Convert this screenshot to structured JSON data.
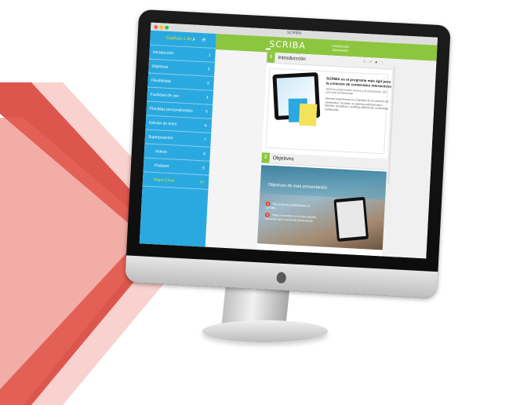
{
  "window": {
    "title": "SCRIBA"
  },
  "sidebar": {
    "chapter": "Capítulo 1 de 4",
    "items": [
      {
        "label": "Introducción",
        "num": "1"
      },
      {
        "label": "Objetivos",
        "num": "2"
      },
      {
        "label": "Flexibilidad",
        "num": "3"
      },
      {
        "label": "Facilidad de uso",
        "num": "4"
      },
      {
        "label": "Plantillas personalizadas",
        "num": "5"
      },
      {
        "label": "Edición de texto",
        "num": "6"
      },
      {
        "label": "Superposición",
        "num": "7"
      },
      {
        "label": "Videos",
        "num": "8"
      },
      {
        "label": "Podcast",
        "num": "9"
      },
      {
        "label": "Mapa Clave",
        "num": "10"
      }
    ]
  },
  "topbar": {
    "logo": "SCRIBA",
    "center_line1": "Introducción",
    "center_line2": "Bienvenido"
  },
  "sections": [
    {
      "num": "1",
      "title": "Introducción",
      "card_title": "SCRIBA es el programa más ágil para la creación de contenidos interactivos",
      "card_sub": "Aúna la comprensión lectora y la interacción, ¡En una sola herramienta!",
      "card_text": "Nuestra experiencia en el ámbito de la creación de contenidos, ha dado un sistema editorial para diseñar, actualizar y publicar fácilmente contenidos multimedia."
    },
    {
      "num": "2",
      "title": "Objetivos",
      "hero_title": "Objetivos de esta presentación",
      "bullets": [
        {
          "n": "1",
          "text": "Presentar las posibilidades de SCRIBA."
        },
        {
          "n": "2",
          "text": "Saber el sentido con el que diseñar elementos que conocerás brevemente."
        }
      ]
    }
  ],
  "colors": {
    "sidebar": "#2aa9e0",
    "accent_green": "#8cc63f",
    "highlight": "#cde93a",
    "chevron_red": "#d9443a"
  }
}
